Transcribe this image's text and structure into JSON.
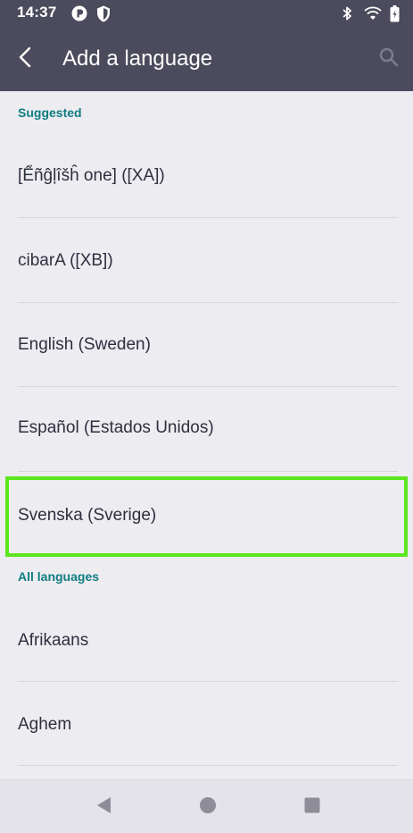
{
  "status_bar": {
    "time": "14:37",
    "icons": [
      "p-badge-icon",
      "shield-icon",
      "bluetooth-icon",
      "wifi-icon",
      "battery-icon"
    ]
  },
  "app_bar": {
    "title": "Add a language",
    "back_icon": "back-arrow-icon",
    "search_icon": "search-icon"
  },
  "sections": {
    "suggested": {
      "title": "Suggested",
      "items": [
        "[Ểñĝļîšĥ one] ([XA])",
        "cibarA ([XB])",
        "English (Sweden)",
        "Español (Estados Unidos)",
        "Svenska (Sverige)"
      ]
    },
    "all": {
      "title": "All languages",
      "items": [
        "Afrikaans",
        "Aghem"
      ]
    }
  },
  "highlighted_item": "Svenska (Sverige)",
  "colors": {
    "app_bar": "#4b4b5d",
    "background": "#edecf1",
    "section_header": "#0f7d80",
    "highlight": "#5ce61c"
  },
  "nav_bar": {
    "icons": [
      "back-triangle-icon",
      "home-circle-icon",
      "recents-square-icon"
    ]
  }
}
